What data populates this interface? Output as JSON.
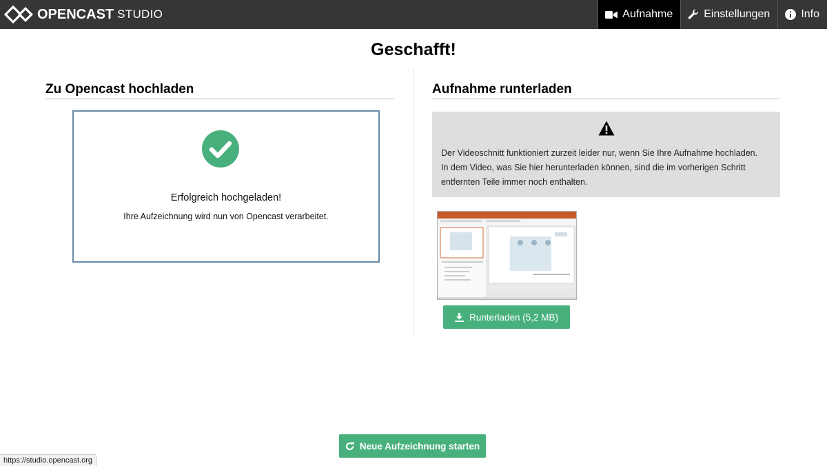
{
  "header": {
    "brand_name": "OPENCAST",
    "brand_sub": "STUDIO",
    "nav": [
      {
        "label": "Aufnahme",
        "icon": "video-camera-icon",
        "active": true
      },
      {
        "label": "Einstellungen",
        "icon": "wrench-icon",
        "active": false
      },
      {
        "label": "Info",
        "icon": "info-icon",
        "active": false
      }
    ]
  },
  "page": {
    "title": "Geschafft!"
  },
  "upload_section": {
    "title": "Zu Opencast hochladen",
    "message": "Erfolgreich hochgeladen!",
    "sub_message": "Ihre Aufzeichnung wird nun von Opencast verarbeitet."
  },
  "download_section": {
    "title": "Aufnahme runterladen",
    "warning_line1": "Der Videoschnitt funktioniert zurzeit leider nur, wenn Sie Ihre Aufnahme hochladen.",
    "warning_line2": "In dem Video, was Sie hier herunterladen können, sind die im vorherigen Schritt",
    "warning_line3": "entfernten Teile immer noch enthalten.",
    "download_label": "Runterladen (5,2 MB)"
  },
  "footer": {
    "new_recording_label": "Neue Aufzeichnung starten"
  },
  "statusbar": {
    "url": "https://studio.opencast.org"
  },
  "colors": {
    "header_bg": "#363636",
    "accent_green": "#48b07d",
    "upload_border": "#6a8aa6",
    "warning_bg": "#dedede"
  }
}
